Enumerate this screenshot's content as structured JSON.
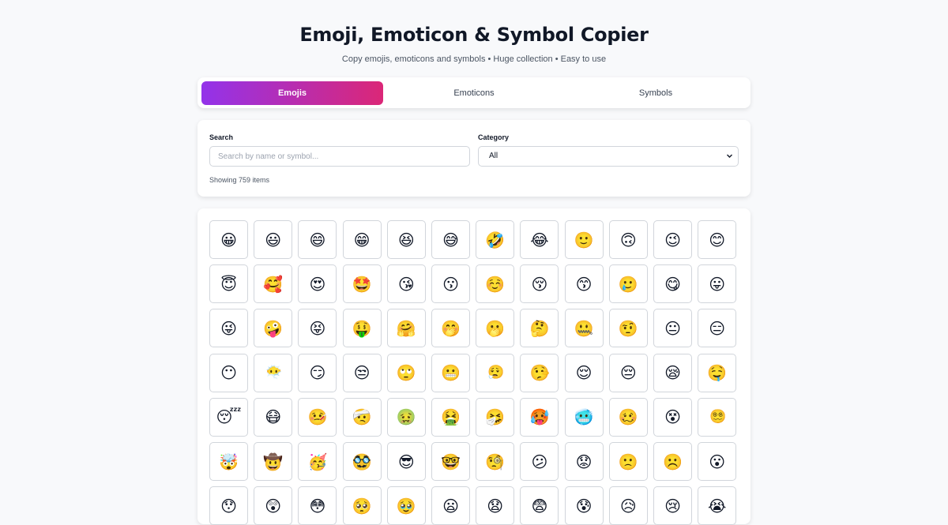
{
  "header": {
    "title": "Emoji, Emoticon & Symbol Copier",
    "subtitle": "Copy emojis, emoticons and symbols • Huge collection • Easy to use"
  },
  "tabs": [
    {
      "label": "Emojis",
      "active": true
    },
    {
      "label": "Emoticons",
      "active": false
    },
    {
      "label": "Symbols",
      "active": false
    }
  ],
  "filters": {
    "search_label": "Search",
    "search_placeholder": "Search by name or symbol...",
    "search_value": "",
    "category_label": "Category",
    "category_value": "All",
    "count_text": "Showing 759 items"
  },
  "colors": {
    "accent_start": "#9333ea",
    "accent_end": "#db2777"
  },
  "grid": {
    "rows": [
      [
        "😀",
        "😃",
        "😄",
        "😁",
        "😆",
        "😅",
        "🤣",
        "😂",
        "🙂",
        "🙃",
        "😉",
        "😊"
      ],
      [
        "😇",
        "🥰",
        "😍",
        "🤩",
        "😘",
        "😗",
        "☺️",
        "😚",
        "😙",
        "🥲",
        "😋",
        "😛"
      ],
      [
        "😜",
        "🤪",
        "😝",
        "🤑",
        "🤗",
        "🤭",
        "🫢",
        "🤔",
        "🤐",
        "🤨",
        "😐",
        "😑"
      ],
      [
        "😶",
        "😶‍🌫️",
        "😏",
        "😒",
        "🙄",
        "😬",
        "😮‍💨",
        "🤥",
        "😌",
        "😔",
        "😪",
        "🤤"
      ],
      [
        "😴",
        "😷",
        "🤒",
        "🤕",
        "🤢",
        "🤮",
        "🤧",
        "🥵",
        "🥶",
        "🥴",
        "😵",
        "😵‍💫"
      ],
      [
        "🤯",
        "🤠",
        "🥳",
        "🥸",
        "😎",
        "🤓",
        "🧐",
        "😕",
        "😟",
        "🙁",
        "☹️",
        "😮"
      ],
      [
        "😯",
        "😲",
        "😳",
        "🥺",
        "🥹",
        "😦",
        "😧",
        "😨",
        "😰",
        "😥",
        "😢",
        "😭"
      ]
    ]
  }
}
